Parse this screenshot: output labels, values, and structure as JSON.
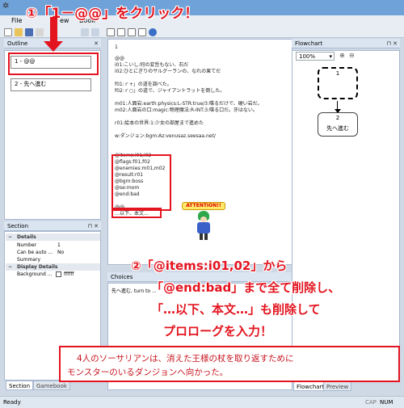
{
  "menu": {
    "file": "File",
    "view": "ew",
    "book": "Book"
  },
  "outline": {
    "title": "Outline",
    "nodes": [
      {
        "label": "1 - @@"
      },
      {
        "label": "2 - 先へ進む"
      }
    ]
  },
  "section": {
    "title": "Section",
    "categories": {
      "details": "Details",
      "display": "Display Details"
    },
    "rows": [
      {
        "name": "Number",
        "value": "1"
      },
      {
        "name": "Can be auto ...",
        "value": "No"
      },
      {
        "name": "Summary",
        "value": ""
      },
      {
        "name": "Background ...",
        "value": "ffffff"
      }
    ]
  },
  "bottom_tabs": {
    "section": "Section",
    "gamebook": "Gamebook"
  },
  "editor": {
    "section_number": "1",
    "lines": [
      "@@",
      "i01:こいし:何の変哲もない、石だ",
      "i02:ひとにぎりのサルグーランの、なれの果てだ",
      "",
      "f01:ｒ+」の道を調べた。",
      "f02:ｒ○」の道で、ジャイアントラットを倒した。",
      "",
      "m01:人面岩:earth:physics:L-STR:true/3:喋るだけで、硬い岩だ。",
      "m02:人面岩の口:magic:物理魔法:R-INT:3:喋る口だ。牙はない。",
      "",
      "r01:絵本の世界:1:少女の部屋まで進めた",
      "",
      "w:ダンジョン:bgm:Az:venusaz.seesaa.net/",
      "",
      "@items:i01,i02",
      "@flags:f01,f02",
      "@enemies:m01,m02",
      "@result:r01",
      "@bgm:boss",
      "@se:mom",
      "@end:bad",
      "@@",
      "…以下、本文…"
    ]
  },
  "choices": {
    "title": "Choices",
    "value": "先へ進む, turn to ..."
  },
  "flowchart": {
    "title": "Flowchart",
    "zoom": "100%",
    "nodes": [
      {
        "number": "1",
        "label": ""
      },
      {
        "number": "2",
        "label": "先へ進む"
      }
    ]
  },
  "flow_tabs": {
    "flowchart": "Flowchart",
    "preview": "Preview"
  },
  "status": {
    "left": "Ready",
    "caps": "CAP",
    "num": "NUM"
  },
  "annotations": {
    "step1": "①「1－@@」をクリック！",
    "attention": "ATTENTION!!",
    "step2_line1": "②「@items:i01,02」から",
    "step2_line2": "「@end:bad」まで全て削除し、",
    "step2_line3": "「…以下、本文…」も削除して",
    "step2_line4": "プロローグを入力！",
    "prologue_line1": "4人のソーサリアンは、消えた王様の杖を取り返すために",
    "prologue_line2": "モンスターのいるダンジョンへ向かった。"
  },
  "colors": {
    "accent_red": "#e3141f",
    "titlebar": "#6fa2d8",
    "panel_header": "#dbe5f1"
  }
}
